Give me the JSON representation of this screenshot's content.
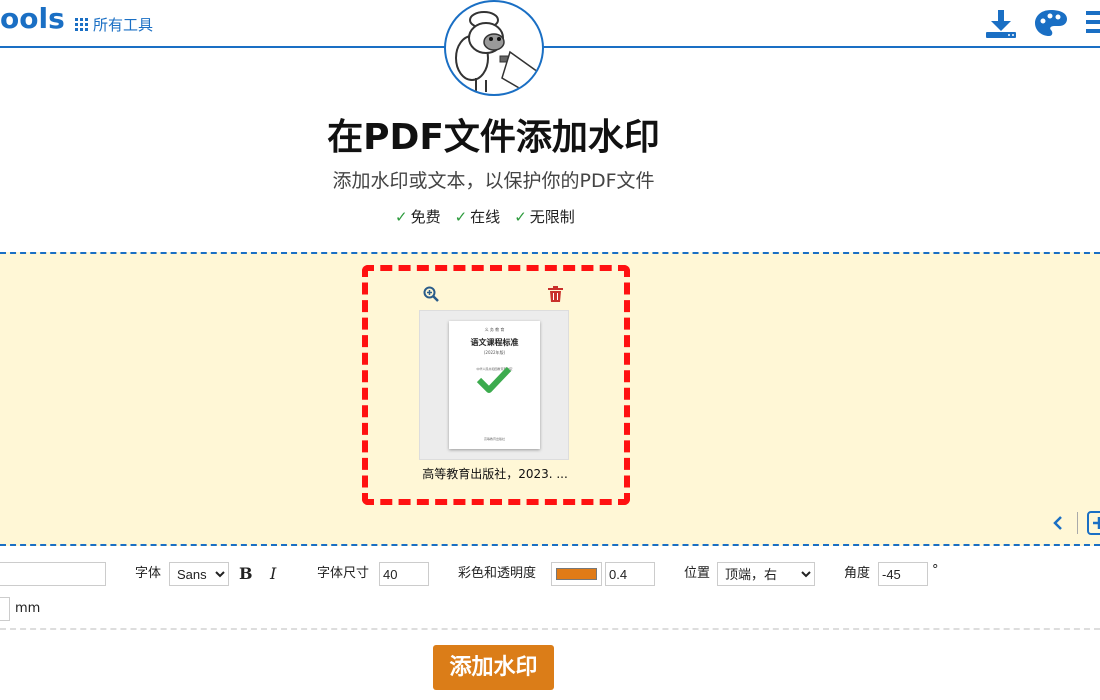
{
  "header": {
    "logo_text": "ools",
    "all_tools_label": "所有工具",
    "colors": {
      "brand": "#1a6fc4"
    }
  },
  "hero": {
    "title": "在PDF文件添加水印",
    "subtitle": "添加水印或文本，以保护你的PDF文件",
    "features": [
      "免费",
      "在线",
      "无限制"
    ],
    "check_mark": "✓"
  },
  "file_card": {
    "file_name": "高等教育出版社，2023. ...",
    "thumbnail": {
      "line1": "义 务 教 育",
      "line2": "语文课程标准",
      "line3": "(2022年版)",
      "line4": "中华人民共和国教育部制定",
      "line5": "高等教育出版社"
    }
  },
  "options": {
    "text_value": "",
    "font_label": "字体",
    "font_value": "Sans",
    "bold_label": "B",
    "italic_label": "I",
    "size_label": "字体尺寸",
    "size_value": "40",
    "color_label": "彩色和透明度",
    "color_value": "#e07b17",
    "opacity_value": "0.4",
    "position_label": "位置",
    "position_value": "顶端，右",
    "angle_label": "角度",
    "angle_value": "-45",
    "degree_symbol": "°",
    "margin_unit": "mm"
  },
  "submit_label": "添加水印",
  "colors": {
    "dropzone_bg": "#fff7d6",
    "highlight_frame": "#ff1111",
    "submit_bg": "#db7d18"
  }
}
